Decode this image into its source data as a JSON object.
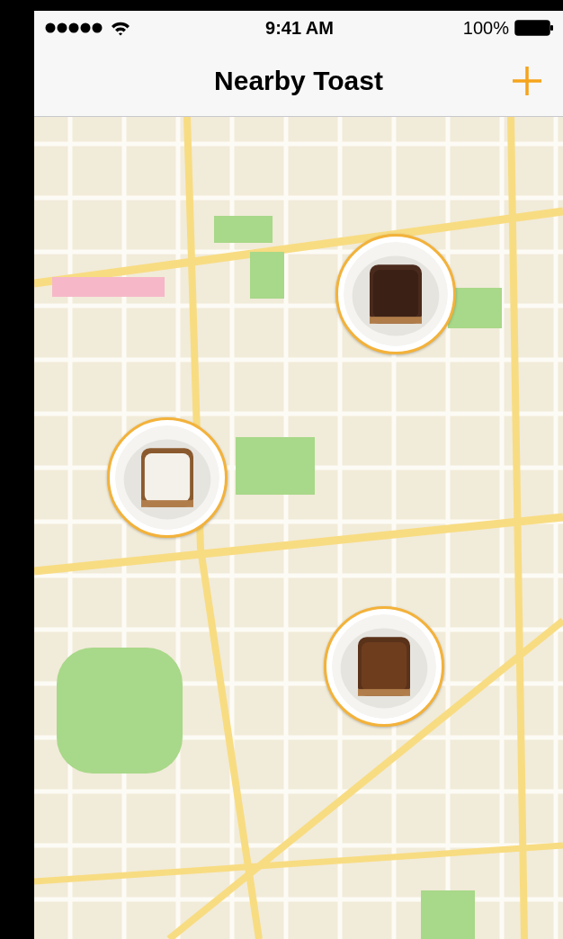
{
  "status_bar": {
    "time": "9:41 AM",
    "battery": "100%"
  },
  "nav_bar": {
    "title": "Nearby Toast"
  }
}
